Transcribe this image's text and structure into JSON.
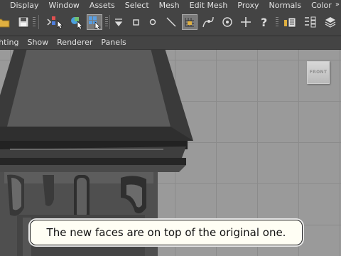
{
  "menubar": {
    "items": [
      "Display",
      "Window",
      "Assets",
      "Select",
      "Mesh",
      "Edit Mesh",
      "Proxy",
      "Normals",
      "Color"
    ],
    "overflow": "»"
  },
  "toolbar": {
    "icons": [
      "open-scene-icon",
      "save-scene-icon",
      "select-by-hierarchy-icon",
      "select-by-object-icon",
      "select-by-component-icon",
      "vertex-mode-icon",
      "edge-mode-icon",
      "face-mode-icon",
      "uv-mode-icon",
      "snap-to-grid-icon",
      "snap-to-curve-icon",
      "snap-to-point-icon",
      "snap-to-view-plane-icon",
      "make-live-icon",
      "history-icon",
      "input-output-icon",
      "render-icon"
    ],
    "active": "select-by-component-icon"
  },
  "panel_menu": {
    "items": [
      "Lighting",
      "Show",
      "Renderer",
      "Panels"
    ]
  },
  "viewport": {
    "view_cube_label": "FRONT",
    "grid_color": "#8b8b8b",
    "background_color": "#9a9a9a"
  },
  "caption": {
    "text": "The new faces are on top of the original one."
  }
}
